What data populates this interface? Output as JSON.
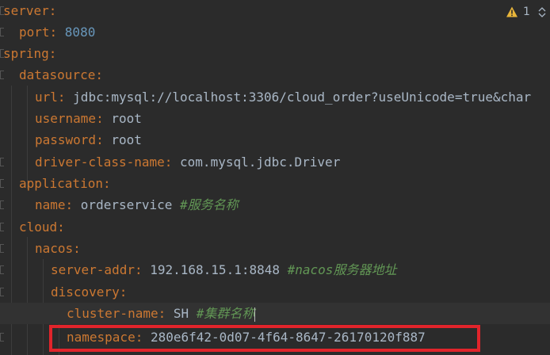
{
  "inspection": {
    "warning_count": "1"
  },
  "code": {
    "lines": [
      {
        "key": "server",
        "sep": ":"
      },
      {
        "key": "port",
        "sep": ": ",
        "value": "8080"
      },
      {
        "key": "spring",
        "sep": ":"
      },
      {
        "key": "datasource",
        "sep": ":"
      },
      {
        "key": "url",
        "sep": ": ",
        "value": "jdbc:mysql://localhost:3306/cloud_order?useUnicode=true&char"
      },
      {
        "key": "username",
        "sep": ": ",
        "value": "root"
      },
      {
        "key": "password",
        "sep": ": ",
        "value": "root"
      },
      {
        "key": "driver-class-name",
        "sep": ": ",
        "value": "com.mysql.jdbc.Driver"
      },
      {
        "key": "application",
        "sep": ":"
      },
      {
        "key": "name",
        "sep": ": ",
        "value": "orderservice",
        "comment": "#服务名称"
      },
      {
        "key": "cloud",
        "sep": ":"
      },
      {
        "key": "nacos",
        "sep": ":"
      },
      {
        "key": "server-addr",
        "sep": ": ",
        "value": "192.168.15.1:8848",
        "comment": "#nacos服务器地址"
      },
      {
        "key": "discovery",
        "sep": ":"
      },
      {
        "key": "cluster-name",
        "sep": ": ",
        "value": "SH",
        "comment": "#集群名称"
      },
      {
        "key": "namespace",
        "sep": ": ",
        "value": "280e6f42-0d07-4f64-8647-26170120f887"
      }
    ]
  },
  "colors": {
    "background": "#2b2b2b",
    "key": "#cc7832",
    "number": "#6897bb",
    "text": "#a9b7c6",
    "comment": "#629755",
    "highlight_box": "#e1242b",
    "warning": "#e8b53a"
  },
  "icons": {
    "warning": "warning-triangle-icon",
    "prev": "chevron-up-icon",
    "next": "chevron-down-icon"
  }
}
